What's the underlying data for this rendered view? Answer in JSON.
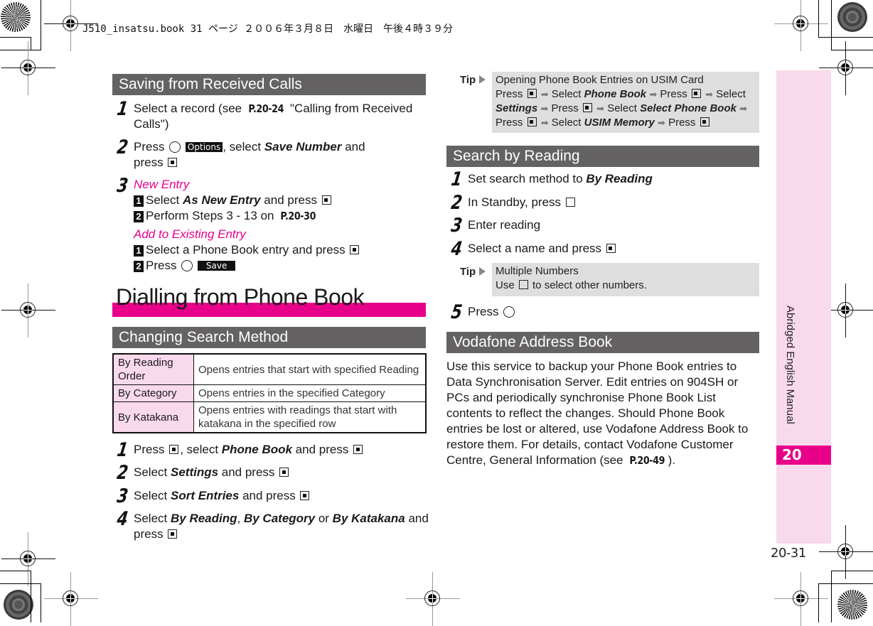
{
  "print_header": "J510_insatsu.book  31 ページ  ２００６年３月８日　水曜日　午後４時３９分",
  "left": {
    "section1": {
      "title": "Saving from Received Calls",
      "step1": {
        "num": "1",
        "text_a": "Select a record (see ",
        "ref": "P.20-24",
        "text_b": " \"Calling from Received Calls\")"
      },
      "step2": {
        "num": "2",
        "text_a": "Press ",
        "softkey": "Options",
        "text_b": ", select ",
        "em": "Save Number",
        "text_c": " and press "
      },
      "step3": {
        "num": "3",
        "new_entry_label": "New Entry",
        "new_entry_sub1": {
          "num": "1",
          "a": "Select ",
          "em": "As New Entry",
          "b": " and press "
        },
        "new_entry_sub2": {
          "num": "2",
          "a": "Perform Steps 3 - 13 on ",
          "ref": "P.20-30"
        },
        "existing_label": "Add to Existing Entry",
        "existing_sub1": {
          "num": "1",
          "a": "Select a Phone Book entry and press "
        },
        "existing_sub2": {
          "num": "2",
          "a": "Press ",
          "softkey": "Save"
        }
      }
    },
    "big_title": "Dialling from Phone Book",
    "section2": {
      "title": "Changing Search Method",
      "table": [
        {
          "label": "By Reading Order",
          "desc": "Opens entries that start with specified Reading"
        },
        {
          "label": "By Category",
          "desc": "Opens entries in the specified Category"
        },
        {
          "label": "By Katakana",
          "desc": "Opens entries with readings that start with katakana in the specified row"
        }
      ],
      "step1": {
        "num": "1",
        "a": "Press ",
        "b": ", select ",
        "em": "Phone Book",
        "c": " and press "
      },
      "step2": {
        "num": "2",
        "a": "Select ",
        "em": "Settings",
        "b": " and press "
      },
      "step3": {
        "num": "3",
        "a": "Select ",
        "em": "Sort Entries",
        "b": " and press "
      },
      "step4": {
        "num": "4",
        "a": "Select ",
        "em1": "By Reading",
        "sep": ", ",
        "em2": "By Category",
        "or": " or ",
        "em3": "By Katakana",
        "b": " and press "
      }
    }
  },
  "right": {
    "tip1": {
      "label": "Tip",
      "title": "Opening Phone Book Entries on USIM Card",
      "press": "Press",
      "select": "Select",
      "em_phone_book": "Phone Book",
      "em_settings": "Settings",
      "em_select_phone_book": "Select Phone Book",
      "em_usim": "USIM Memory"
    },
    "section3": {
      "title": "Search by Reading",
      "step1": {
        "num": "1",
        "a": "Set search method to ",
        "em": "By Reading"
      },
      "step2": {
        "num": "2",
        "a": "In Standby, press "
      },
      "step3": {
        "num": "3",
        "a": "Enter reading"
      },
      "step4": {
        "num": "4",
        "a": "Select a name and press "
      },
      "step5": {
        "num": "5",
        "a": "Press "
      }
    },
    "tip2": {
      "label": "Tip",
      "title": "Multiple Numbers",
      "a": "Use ",
      "b": " to select other numbers."
    },
    "section4": {
      "title": "Vodafone Address Book",
      "paragraph": "Use this service to backup your Phone Book entries to Data Synchronisation Server. Edit entries on 904SH or PCs and periodically synchronise Phone Book List contents to reflect the changes. Should Phone Book entries be lost or altered, use Vodafone Address Book to restore them. For details, contact Vodafone Customer Centre, General Information (see ",
      "ref": "P.20-49",
      "end": ")."
    }
  },
  "side": {
    "label": "Abridged English Manual",
    "chapter": "20",
    "page_number": "20-31"
  },
  "colors": {
    "accent": "#e8008a",
    "section_bg": "#656263",
    "tab_bg": "#f9d9ec",
    "tip_bg": "#dedede"
  }
}
